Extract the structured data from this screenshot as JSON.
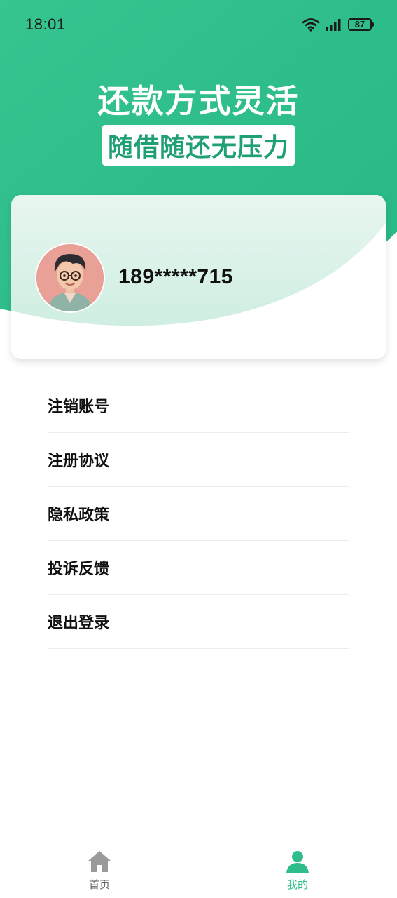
{
  "status_bar": {
    "time": "18:01",
    "battery": "87",
    "icons": [
      "wifi-icon",
      "signal-icon",
      "battery-icon"
    ]
  },
  "banner": {
    "title": "还款方式灵活",
    "subtitle": "随借随还无压力"
  },
  "profile": {
    "phone": "189*****715",
    "avatar": "cartoon-boy-avatar"
  },
  "menu": {
    "items": [
      {
        "label": "注销账号"
      },
      {
        "label": "注册协议"
      },
      {
        "label": "隐私政策"
      },
      {
        "label": "投诉反馈"
      },
      {
        "label": "退出登录"
      }
    ]
  },
  "tabbar": {
    "home_label": "首页",
    "mine_label": "我的",
    "active": "mine"
  },
  "colors": {
    "brand_green": "#2fbe8a",
    "brand_green_dark": "#1f9f74",
    "inactive_tab": "#9a9a9a"
  }
}
